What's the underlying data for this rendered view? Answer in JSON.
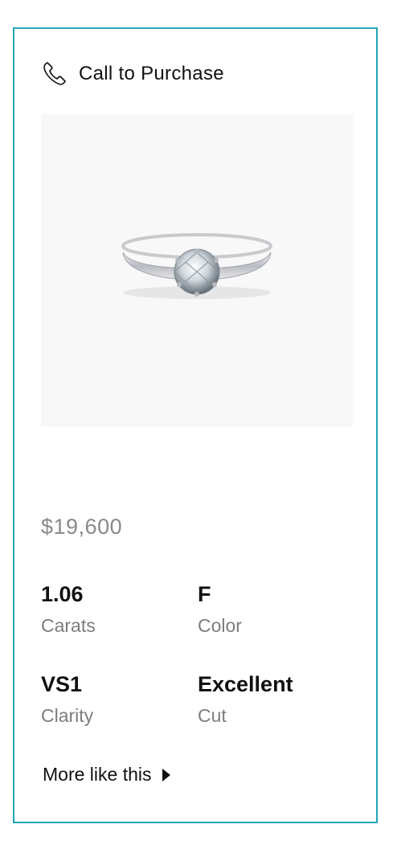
{
  "card": {
    "call_label": "Call to Purchase",
    "price": "$19,600",
    "specs": [
      {
        "value": "1.06",
        "label": "Carats"
      },
      {
        "value": "F",
        "label": "Color"
      },
      {
        "value": "VS1",
        "label": "Clarity"
      },
      {
        "value": "Excellent",
        "label": "Cut"
      }
    ],
    "more_link": "More like this",
    "product_image": "diamond-solitaire-ring-image"
  },
  "colors": {
    "border": "#22a6b8",
    "price": "#8a8a8a",
    "label": "#7d7d7d",
    "image_bg": "#f8f8f8"
  },
  "icons": {
    "phone": "phone-icon",
    "more": "caret-right-icon"
  }
}
